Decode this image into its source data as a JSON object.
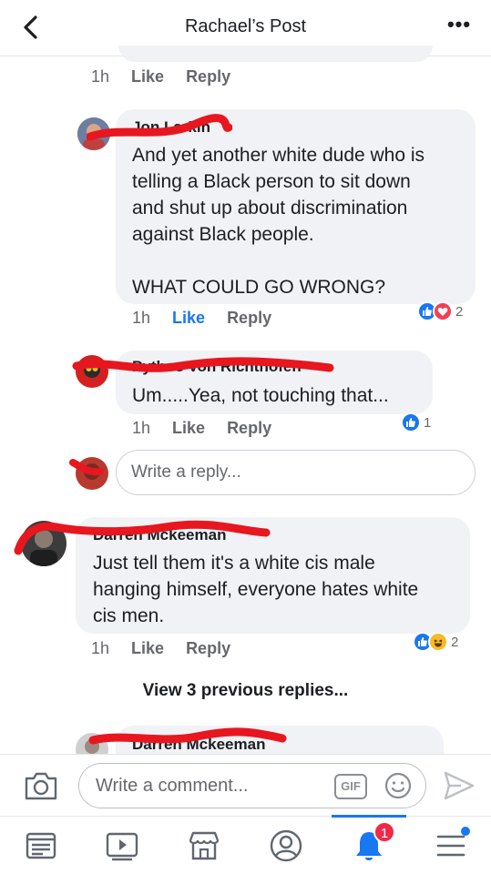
{
  "header": {
    "title": "Rachael’s Post",
    "more_label": "•••"
  },
  "comments": [
    {
      "time": "1h",
      "like": "Like",
      "reply": "Reply"
    },
    {
      "author": "Jon Larkin",
      "text": "And yet another white dude who is\ntelling a Black person to sit down\nand shut up about discrimination\nagainst Black people.\n\nWHAT COULD GO WRONG?",
      "time": "1h",
      "like": "Like",
      "reply": "Reply",
      "reaction_count": "2"
    },
    {
      "author": "Pythos Von Richthofen",
      "text": "Um.....Yea, not touching that...",
      "time": "1h",
      "like": "Like",
      "reply": "Reply",
      "reaction_count": "1"
    },
    {
      "author": "Darren Mckeeman",
      "text": "Just tell them it's a white cis male\nhanging himself, everyone hates white\ncis men.",
      "time": "1h",
      "like": "Like",
      "reply": "Reply",
      "reaction_count": "2"
    },
    {
      "author": "Darren Mckeeman"
    }
  ],
  "reply_box": {
    "placeholder": "Write a reply..."
  },
  "view_previous": "View 3 previous replies...",
  "comment_bar": {
    "placeholder": "Write a comment...",
    "gif_label": "GIF"
  },
  "nav": {
    "notification_count": "1"
  },
  "colors": {
    "accent": "#1877f2",
    "bubble": "#f0f2f5",
    "redaction": "#e8161f",
    "badge": "#f02849"
  }
}
